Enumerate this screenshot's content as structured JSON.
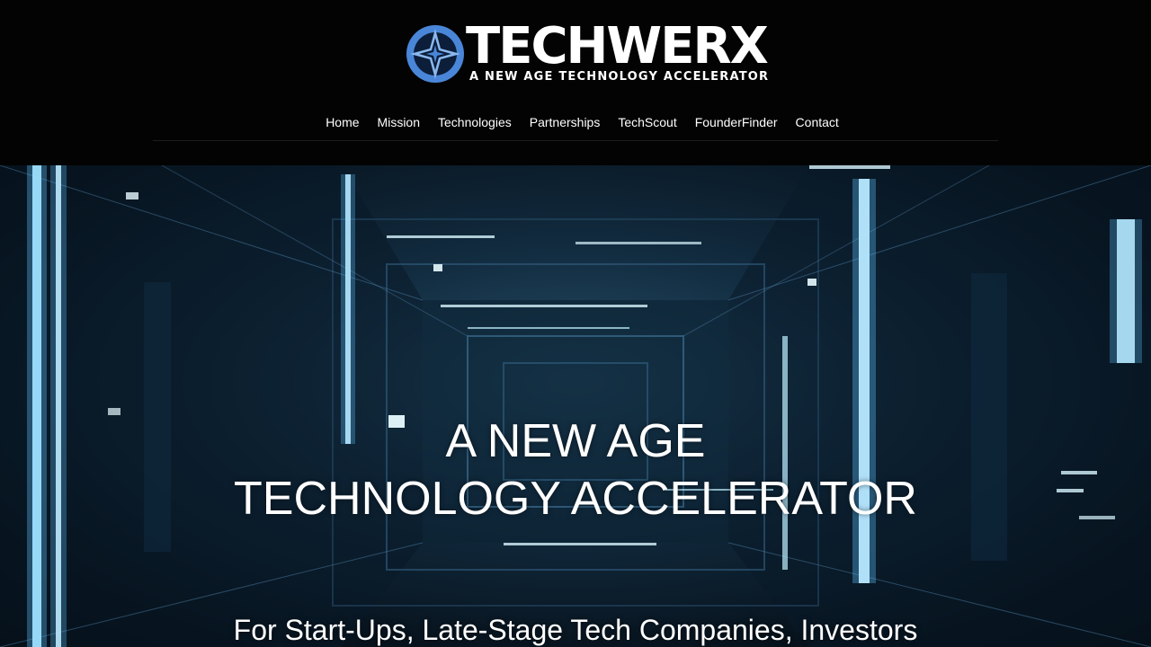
{
  "brand": {
    "name": "TECHWERX",
    "tagline": "A NEW AGE TECHNOLOGY ACCELERATOR",
    "logo_icon": "four-point-star-circle-logo",
    "colors": {
      "logo_blue": "#4a86d8",
      "logo_light": "#8ab8ee",
      "header_bg": "#030303"
    }
  },
  "nav": {
    "items": [
      {
        "label": "Home"
      },
      {
        "label": "Mission"
      },
      {
        "label": "Technologies"
      },
      {
        "label": "Partnerships"
      },
      {
        "label": "TechScout"
      },
      {
        "label": "FounderFinder"
      },
      {
        "label": "Contact"
      }
    ]
  },
  "hero": {
    "title_line1": "A NEW AGE",
    "title_line2": "TECHNOLOGY ACCELERATOR",
    "subtitle": "For Start-Ups, Late-Stage Tech Companies, Investors"
  }
}
